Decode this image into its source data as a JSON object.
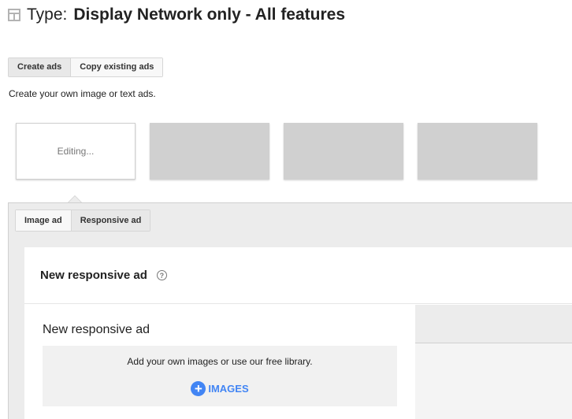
{
  "header": {
    "icon": "layout-icon",
    "type_label": "Type:",
    "type_value": "Display Network only - All features"
  },
  "mode_tabs": [
    {
      "label": "Create ads",
      "active": true
    },
    {
      "label": "Copy existing ads",
      "active": false
    }
  ],
  "description": "Create your own image or text ads.",
  "thumbnails": {
    "editing_label": "Editing...",
    "placeholder_count": 3
  },
  "ad_type_tabs": [
    {
      "label": "Image ad",
      "active": false
    },
    {
      "label": "Responsive ad",
      "active": true
    }
  ],
  "card": {
    "title": "New responsive ad",
    "help_icon": "?",
    "editor": {
      "title": "New responsive ad",
      "drop_text": "Add your own images or use our free library.",
      "add_button_icon": "+",
      "add_button_label": "IMAGES"
    }
  },
  "colors": {
    "accent": "#4285f4",
    "placeholder": "#d0d0d0",
    "panel_bg": "#ececec"
  }
}
